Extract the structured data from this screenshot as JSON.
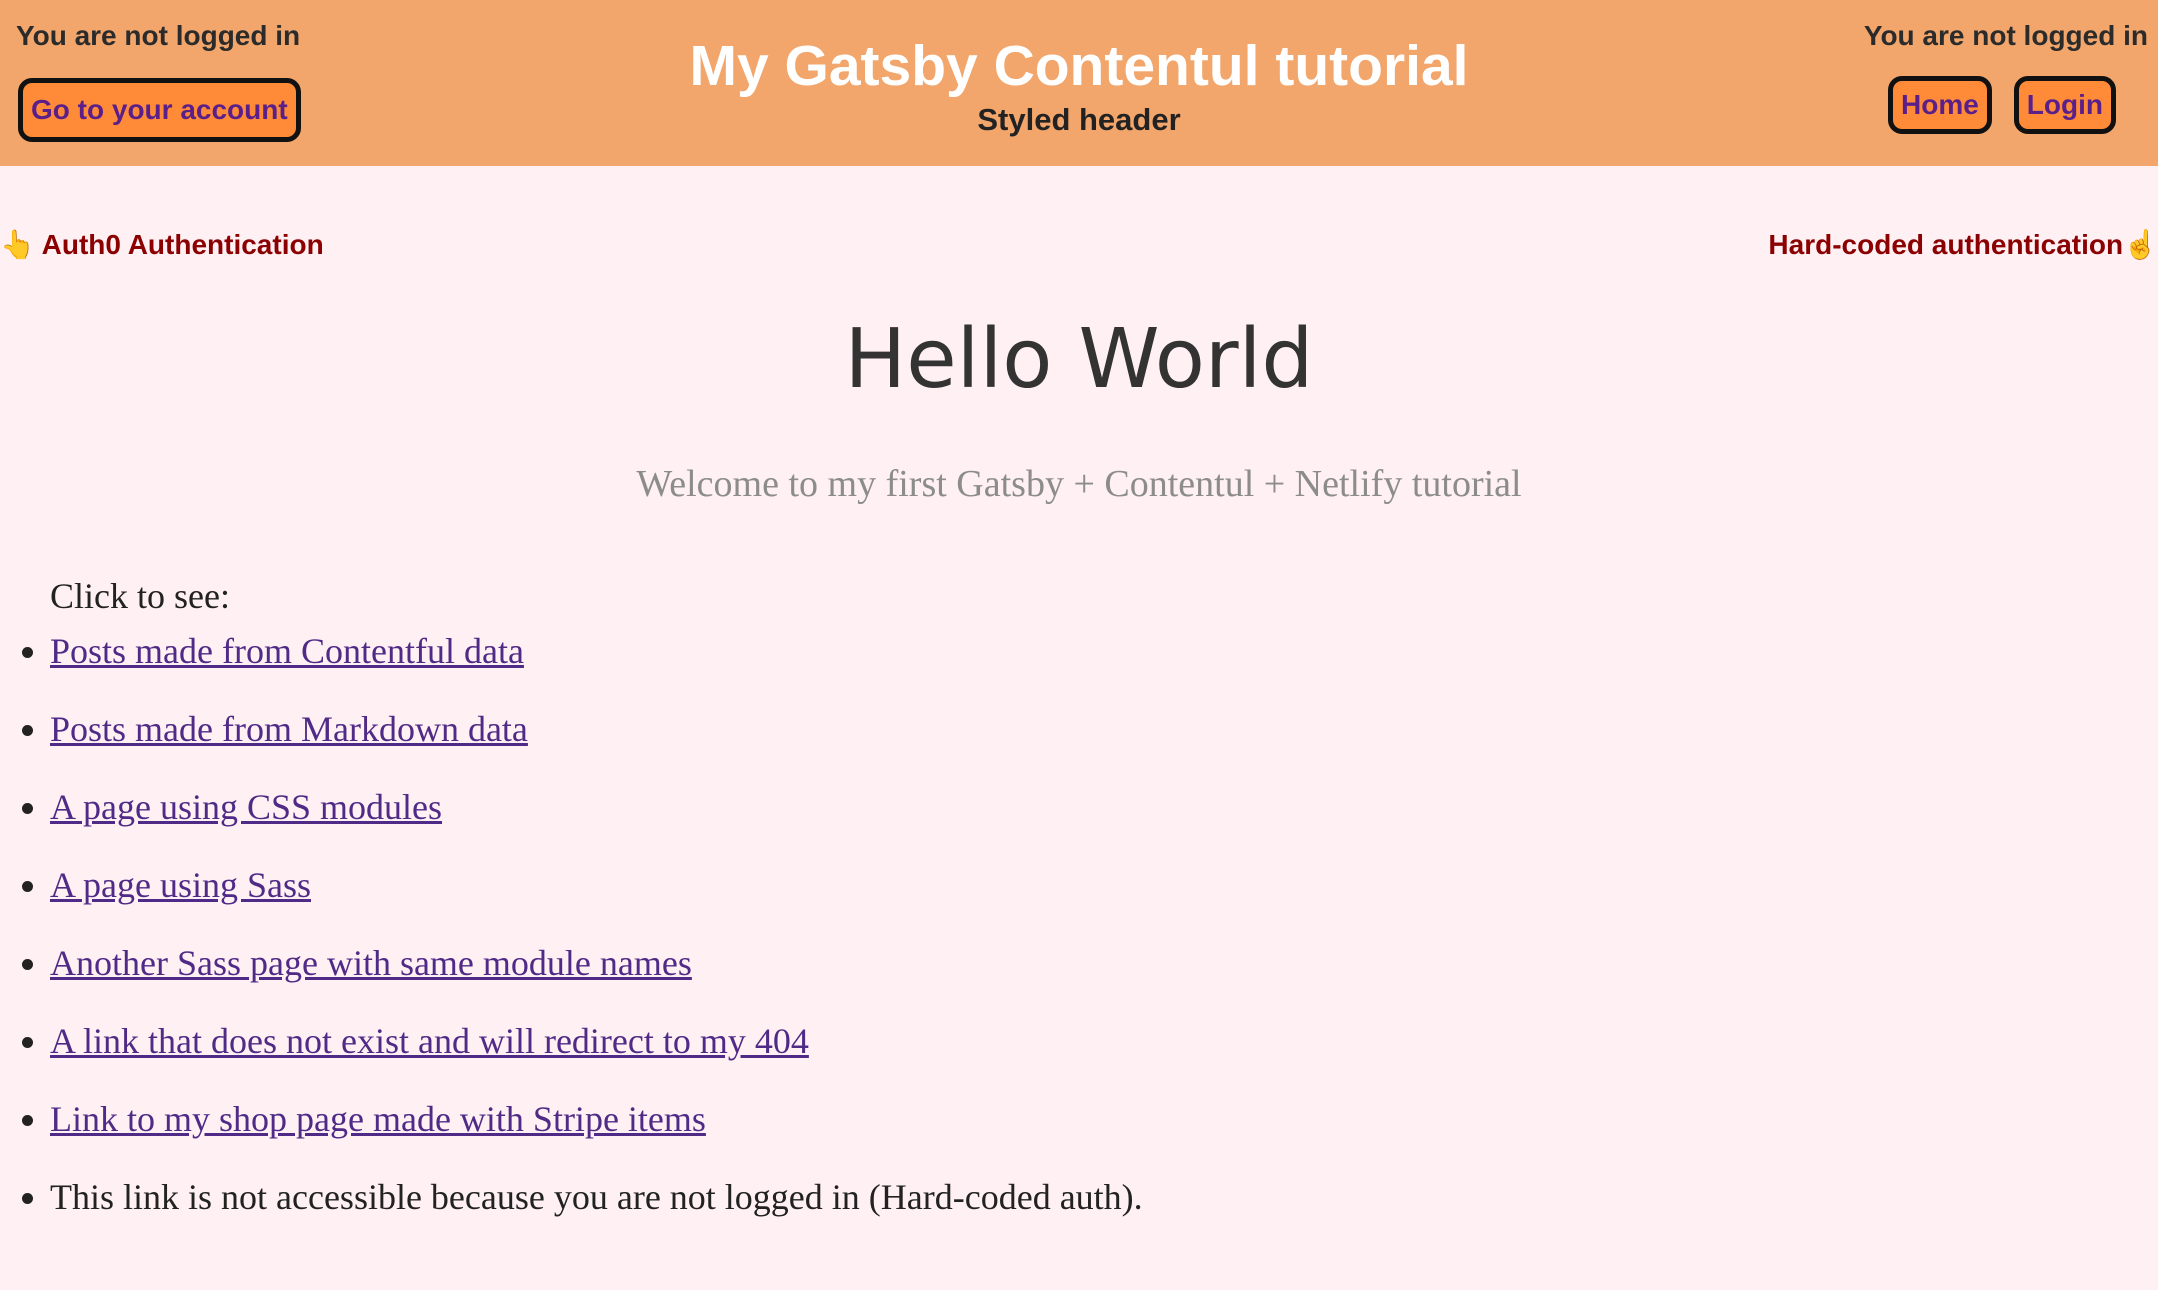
{
  "header": {
    "status_left": "You are not logged in",
    "account_button": "Go to your account",
    "title": "My Gatsby Contentul tutorial",
    "subtitle": "Styled header",
    "status_right": "You are not logged in",
    "nav": {
      "home": "Home",
      "login": "Login"
    }
  },
  "auth_links": {
    "left_emoji": "👆",
    "left": "Auth0 Authentication",
    "right": "Hard-coded authentication",
    "right_emoji": "☝"
  },
  "main": {
    "heading": "Hello World",
    "welcome": "Welcome to my first Gatsby + Contentul + Netlify tutorial",
    "click_label": "Click to see:",
    "links": [
      "Posts made from Contentful data",
      "Posts made from Markdown data",
      "A page using CSS modules",
      "A page using Sass",
      "Another Sass page with same module names",
      "A link that does not exist and will redirect to my 404",
      "Link to my shop page made with Stripe items"
    ],
    "locked_item": "This link is not accessible because you are not logged in (Hard-coded auth)."
  },
  "colors": {
    "header_bg": "#f2a66b",
    "page_bg": "#fff0f4",
    "button_bg": "#ff8b38",
    "link": "#4f2a86",
    "auth_link": "#8b0000"
  }
}
